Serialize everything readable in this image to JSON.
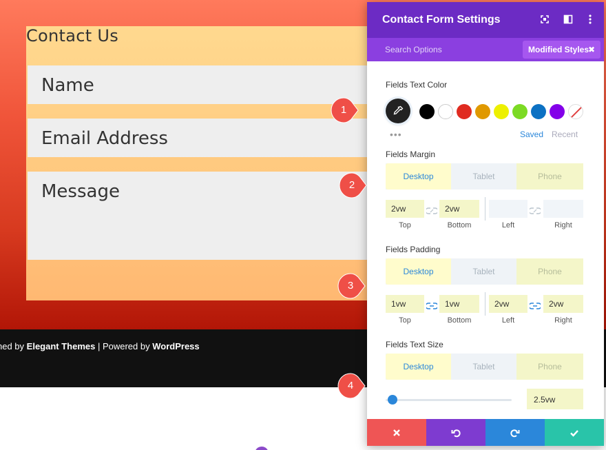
{
  "page": {
    "form_title": "Contact Us",
    "fields": [
      "Name",
      "Email Address",
      "Message"
    ],
    "footer": {
      "designed_prefix": "ned by ",
      "designed_brand": "Elegant Themes",
      "separator": " | Powered by ",
      "powered_brand": "WordPress"
    }
  },
  "annotations": [
    "1",
    "2",
    "3",
    "4"
  ],
  "panel": {
    "title": "Contact Form Settings",
    "search_options": "Search Options",
    "modified_styles": "Modified Styles",
    "text_color": {
      "label": "Fields Text Color",
      "swatches": [
        "#000000",
        "#ffffff",
        "#e02b20",
        "#e09900",
        "#edf000",
        "#7cda24",
        "#0c71c3",
        "#8300e9"
      ],
      "saved": "Saved",
      "recent": "Recent"
    },
    "tabs": {
      "desktop": "Desktop",
      "tablet": "Tablet",
      "phone": "Phone"
    },
    "margin": {
      "label": "Fields Margin",
      "top": "2vw",
      "bottom": "2vw",
      "left": "",
      "right": "",
      "labels": {
        "top": "Top",
        "bottom": "Bottom",
        "left": "Left",
        "right": "Right"
      }
    },
    "padding": {
      "label": "Fields Padding",
      "top": "1vw",
      "bottom": "1vw",
      "left": "2vw",
      "right": "2vw",
      "labels": {
        "top": "Top",
        "bottom": "Bottom",
        "left": "Left",
        "right": "Right"
      }
    },
    "text_size": {
      "label": "Fields Text Size",
      "value": "2.5vw"
    }
  }
}
